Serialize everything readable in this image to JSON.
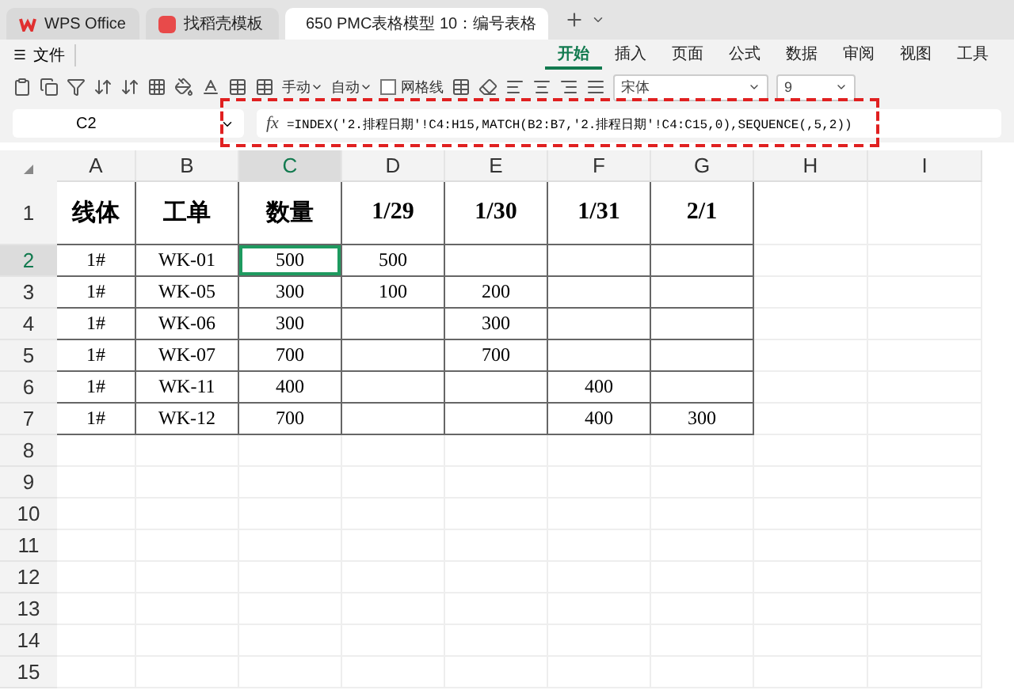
{
  "tabs": [
    {
      "kind": "wps",
      "label": "WPS Office",
      "selected": false
    },
    {
      "kind": "template",
      "label": "找稻壳模板",
      "selected": false
    },
    {
      "kind": "sheet",
      "label": "650 PMC表格模型 10：编号表格",
      "selected": true
    }
  ],
  "menu": {
    "file": "文件",
    "ribbon_tabs": [
      {
        "label": "开始",
        "selected": true
      },
      {
        "label": "插入",
        "selected": false
      },
      {
        "label": "页面",
        "selected": false
      },
      {
        "label": "公式",
        "selected": false
      },
      {
        "label": "数据",
        "selected": false
      },
      {
        "label": "审阅",
        "selected": false
      },
      {
        "label": "视图",
        "selected": false
      },
      {
        "label": "工具",
        "selected": false
      }
    ]
  },
  "toolbar": {
    "row_height": "手动",
    "col_width": "自动",
    "gridlines": {
      "label": "网格线",
      "checked": false
    },
    "font": "宋体",
    "font_size": "9"
  },
  "formula_bar": {
    "name_box": "C2",
    "fx": "fx",
    "formula": "=INDEX('2.排程日期'!C4:H15,MATCH(B2:B7,'2.排程日期'!C4:C15,0),SEQUENCE(,5,2))"
  },
  "sheet": {
    "columns": [
      {
        "label": "A",
        "selected": false
      },
      {
        "label": "B",
        "selected": false
      },
      {
        "label": "C",
        "selected": true
      },
      {
        "label": "D",
        "selected": false
      },
      {
        "label": "E",
        "selected": false
      },
      {
        "label": "F",
        "selected": false
      },
      {
        "label": "G",
        "selected": false
      },
      {
        "label": "H",
        "selected": false
      },
      {
        "label": "I",
        "selected": false
      }
    ],
    "header_row": {
      "number": "1",
      "cells": [
        "线体",
        "工单",
        "数量",
        "1/29",
        "1/30",
        "1/31",
        "2/1"
      ]
    },
    "rows": [
      {
        "number": "2",
        "selected": true,
        "cells": [
          {
            "text": "1#",
            "selected": false
          },
          {
            "text": "WK-01",
            "selected": false
          },
          {
            "text": "500",
            "selected": true
          },
          {
            "text": "500",
            "selected": false
          },
          {
            "selected": false
          },
          {
            "selected": false
          },
          {
            "selected": false
          }
        ]
      },
      {
        "number": "3",
        "selected": false,
        "cells": [
          {
            "text": "1#",
            "selected": false
          },
          {
            "text": "WK-05",
            "selected": false
          },
          {
            "text": "300",
            "selected": false
          },
          {
            "text": "100",
            "selected": false
          },
          {
            "text": "200",
            "selected": false
          },
          {
            "selected": false
          },
          {
            "selected": false
          }
        ]
      },
      {
        "number": "4",
        "selected": false,
        "cells": [
          {
            "text": "1#",
            "selected": false
          },
          {
            "text": "WK-06",
            "selected": false
          },
          {
            "text": "300",
            "selected": false
          },
          {
            "selected": false
          },
          {
            "text": "300",
            "selected": false
          },
          {
            "selected": false
          },
          {
            "selected": false
          }
        ]
      },
      {
        "number": "5",
        "selected": false,
        "cells": [
          {
            "text": "1#",
            "selected": false
          },
          {
            "text": "WK-07",
            "selected": false
          },
          {
            "text": "700",
            "selected": false
          },
          {
            "selected": false
          },
          {
            "text": "700",
            "selected": false
          },
          {
            "selected": false
          },
          {
            "selected": false
          }
        ]
      },
      {
        "number": "6",
        "selected": false,
        "cells": [
          {
            "text": "1#",
            "selected": false
          },
          {
            "text": "WK-11",
            "selected": false
          },
          {
            "text": "400",
            "selected": false
          },
          {
            "selected": false
          },
          {
            "selected": false
          },
          {
            "text": "400",
            "selected": false
          },
          {
            "selected": false
          }
        ]
      },
      {
        "number": "7",
        "selected": false,
        "cells": [
          {
            "text": "1#",
            "selected": false
          },
          {
            "text": "WK-12",
            "selected": false
          },
          {
            "text": "700",
            "selected": false
          },
          {
            "selected": false
          },
          {
            "selected": false
          },
          {
            "text": "400",
            "selected": false
          },
          {
            "text": "300",
            "selected": false
          }
        ]
      }
    ],
    "empty_rows": [
      "8",
      "9",
      "10",
      "11",
      "12",
      "13",
      "14",
      "15"
    ]
  }
}
